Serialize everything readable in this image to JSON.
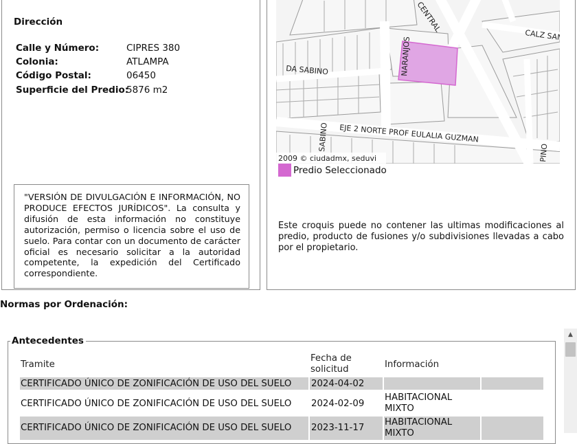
{
  "address": {
    "heading": "Dirección",
    "fields": [
      {
        "label": "Calle y Número:",
        "value": "CIPRES 380"
      },
      {
        "label": "Colonia:",
        "value": "ATLAMPA"
      },
      {
        "label": "Código Postal:",
        "value": "06450"
      },
      {
        "label": "Superficie del Predio:",
        "value": "5876 m2"
      }
    ]
  },
  "disclaimer": "\"VERSIÓN DE DIVULGACIÓN E INFORMACIÓN, NO PRODUCE EFECTOS JURÍDICOS\". La consulta y difusión de esta información no constituye autorización, permiso o licencia sobre el uso de suelo. Para contar con un documento de carácter oficial es necesario solicitar a la autoridad competente, la expedición del Certificado correspondiente.",
  "map": {
    "street_labels": [
      "CENTRAL",
      "CALZ SAN",
      "NARANJOS",
      "DA SABINO",
      "EJE 2 NORTE PROF EULALIA GUZMAN",
      "SABINO",
      "PINO"
    ],
    "attribution": "2009 © ciudadmx, seduvi",
    "legend_label": "Predio Seleccionado",
    "legend_color": "#d468d0",
    "note": "Este croquis puede no contener las ultimas modificaciones al predio, producto de fusiones y/o subdivisiones llevadas a cabo por el propietario."
  },
  "normas_title": "Normas por Ordenación:",
  "antecedentes": {
    "legend": "Antecedentes",
    "columns": {
      "tramite": "Tramite",
      "fecha": "Fecha de solicitud",
      "informacion": "Información"
    },
    "rows": [
      {
        "tramite": "CERTIFICADO ÚNICO DE ZONIFICACIÓN DE USO DEL SUELO",
        "fecha": "2024-04-02",
        "informacion": ""
      },
      {
        "tramite": "CERTIFICADO ÚNICO DE ZONIFICACIÓN DE USO DEL SUELO",
        "fecha": "2024-02-09",
        "informacion": "HABITACIONAL MIXTO"
      },
      {
        "tramite": "CERTIFICADO ÚNICO DE ZONIFICACIÓN DE USO DEL SUELO",
        "fecha": "2023-11-17",
        "informacion": "HABITACIONAL MIXTO"
      }
    ]
  },
  "colors": {
    "row_shade": "#cfcfcf",
    "border": "#8a8a8a"
  }
}
